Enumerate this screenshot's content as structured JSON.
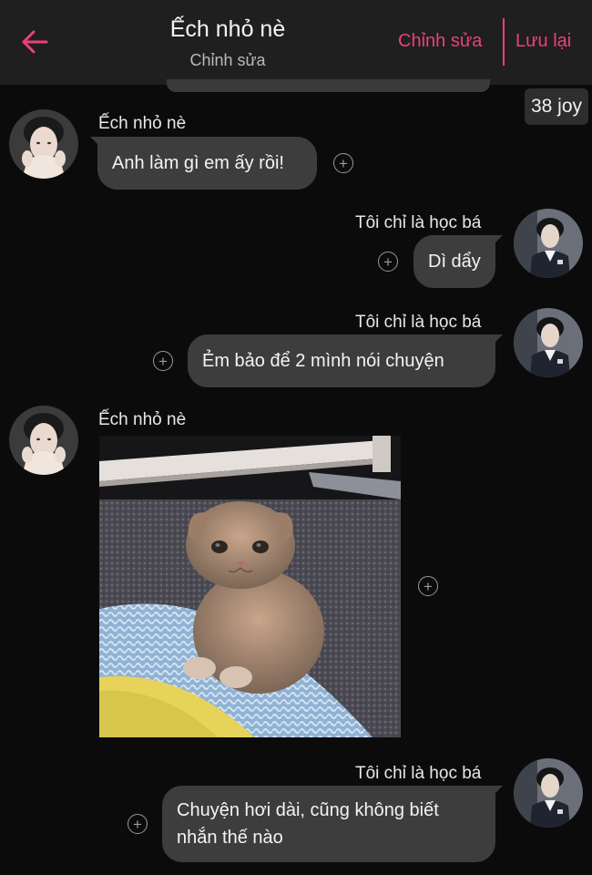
{
  "header": {
    "title": "Ếch nhỏ nè",
    "subtitle": "Chỉnh sửa",
    "edit_label": "Chỉnh sửa",
    "save_label": "Lưu lại",
    "accent_color": "#ec407a"
  },
  "joy_badge": "38 joy",
  "react_symbol": "+",
  "messages": [
    {
      "sender": "Ếch nhỏ nè",
      "side": "left",
      "type": "text",
      "text": "Anh làm gì em ấy rồi!"
    },
    {
      "sender": "Tôi chỉ là học bá",
      "side": "right",
      "type": "text",
      "text": "Dì dẩy"
    },
    {
      "sender": "Tôi chỉ là học bá",
      "side": "right",
      "type": "text",
      "text": "Ẻm bảo để 2 mình nói chuyện"
    },
    {
      "sender": "Ếch nhỏ nè",
      "side": "left",
      "type": "image",
      "image": "grumpy-kitten-photo"
    },
    {
      "sender": "Tôi chỉ là học bá",
      "side": "right",
      "type": "text",
      "text": "Chuyện hơi dài, cũng không biết nhắn thế nào"
    }
  ]
}
